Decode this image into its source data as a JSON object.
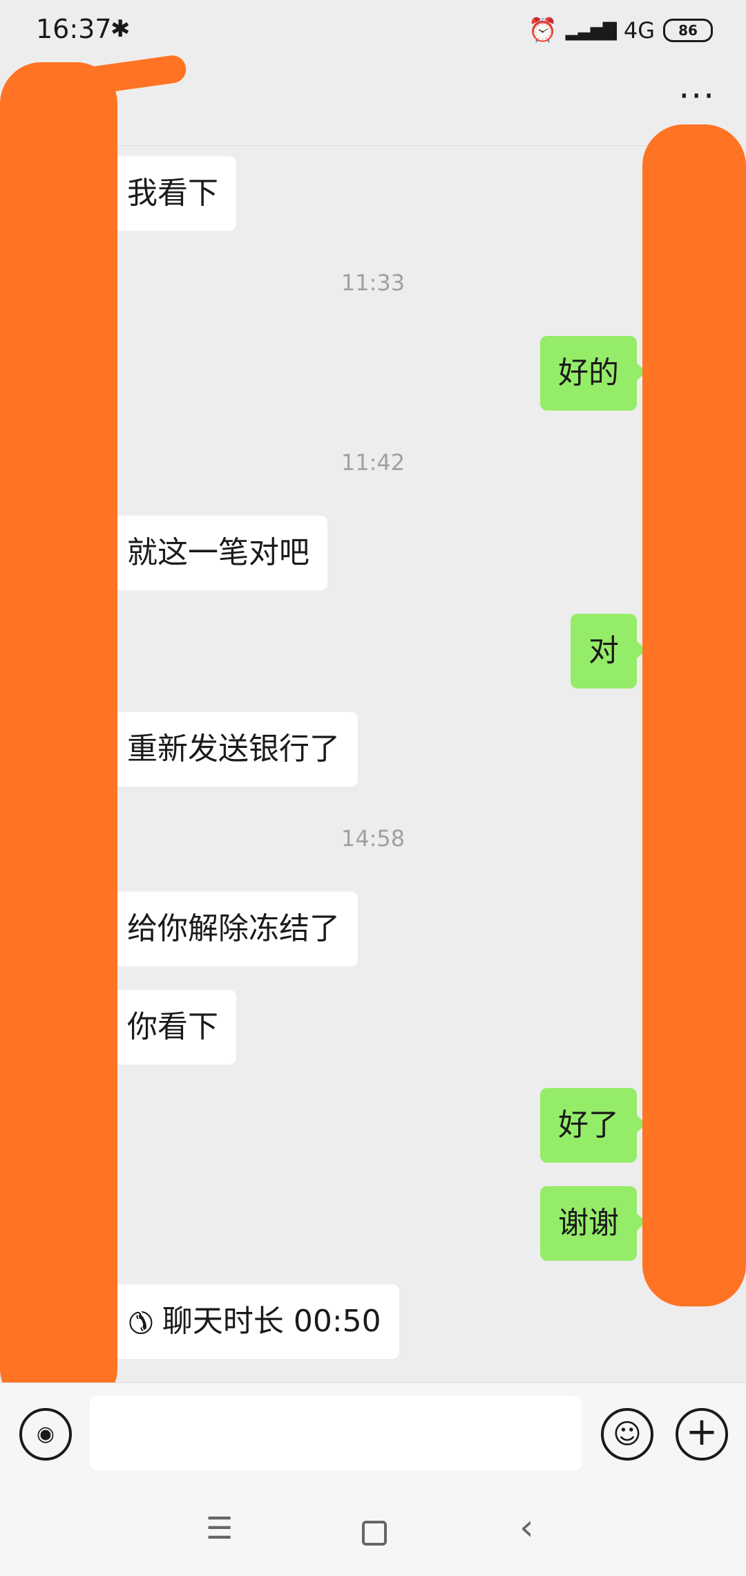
{
  "status_bar": {
    "time": "16:37",
    "bluetooth_icon": "bluetooth-icon",
    "alarm_icon": "alarm-icon",
    "signal_icon": "signal-icon",
    "network": "4G",
    "battery": "86"
  },
  "nav": {
    "back_icon": "chevron-left-icon",
    "more_icon": "more-icon"
  },
  "messages": {
    "m1": "我看下",
    "t1": "11:33",
    "m2": "好的",
    "t2": "11:42",
    "m3": "就这一笔对吧",
    "m4": "对",
    "m5": "重新发送银行了",
    "t3": "14:58",
    "m6": "给你解除冻结了",
    "m7": "你看下",
    "m8": "好了",
    "m9": "谢谢",
    "m10": "聊天时长 00:50"
  },
  "input_bar": {
    "placeholder": "",
    "voice_icon": "voice-icon",
    "emoji_icon": "emoji-icon",
    "plus_icon": "plus-icon"
  },
  "system_nav": {
    "menu_icon": "menu-icon",
    "home_icon": "home-icon",
    "back_icon": "back-icon"
  },
  "colors": {
    "background": "#ededed",
    "bubble_self": "#95ec69",
    "bubble_other": "#ffffff",
    "redaction": "#ff7324"
  }
}
